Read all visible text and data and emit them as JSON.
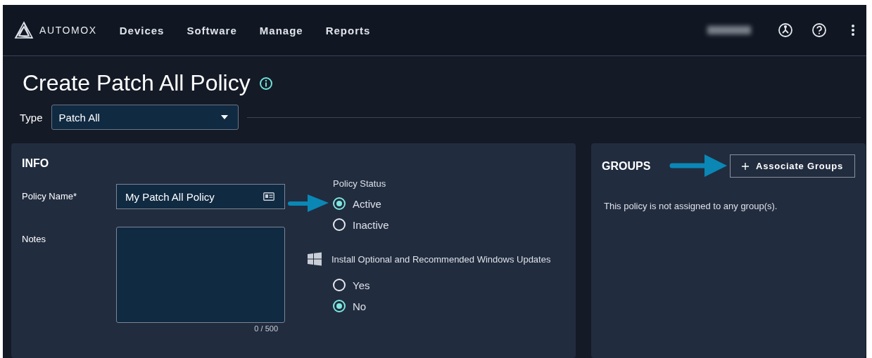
{
  "nav": {
    "brand": "AUTOMOX",
    "items": [
      {
        "label": "Devices"
      },
      {
        "label": "Software"
      },
      {
        "label": "Manage"
      },
      {
        "label": "Reports"
      }
    ]
  },
  "page": {
    "title": "Create Patch All Policy",
    "type_label": "Type",
    "type_value": "Patch All"
  },
  "info": {
    "heading": "INFO",
    "policy_name_label": "Policy Name*",
    "policy_name_value": "My Patch All Policy",
    "notes_label": "Notes",
    "notes_counter": "0 / 500",
    "status_label": "Policy Status",
    "status_options": [
      {
        "label": "Active",
        "selected": true,
        "arrow": true
      },
      {
        "label": "Inactive",
        "selected": false,
        "arrow": false
      }
    ],
    "updates_label": "Install Optional and Recommended Windows Updates",
    "updates_options": [
      {
        "label": "Yes",
        "selected": false,
        "arrow": false
      },
      {
        "label": "No",
        "selected": true,
        "arrow": false
      }
    ]
  },
  "groups": {
    "heading": "GROUPS",
    "button": "Associate Groups",
    "button_arrow": true,
    "empty_text": "This policy is not assigned to any group(s)."
  }
}
